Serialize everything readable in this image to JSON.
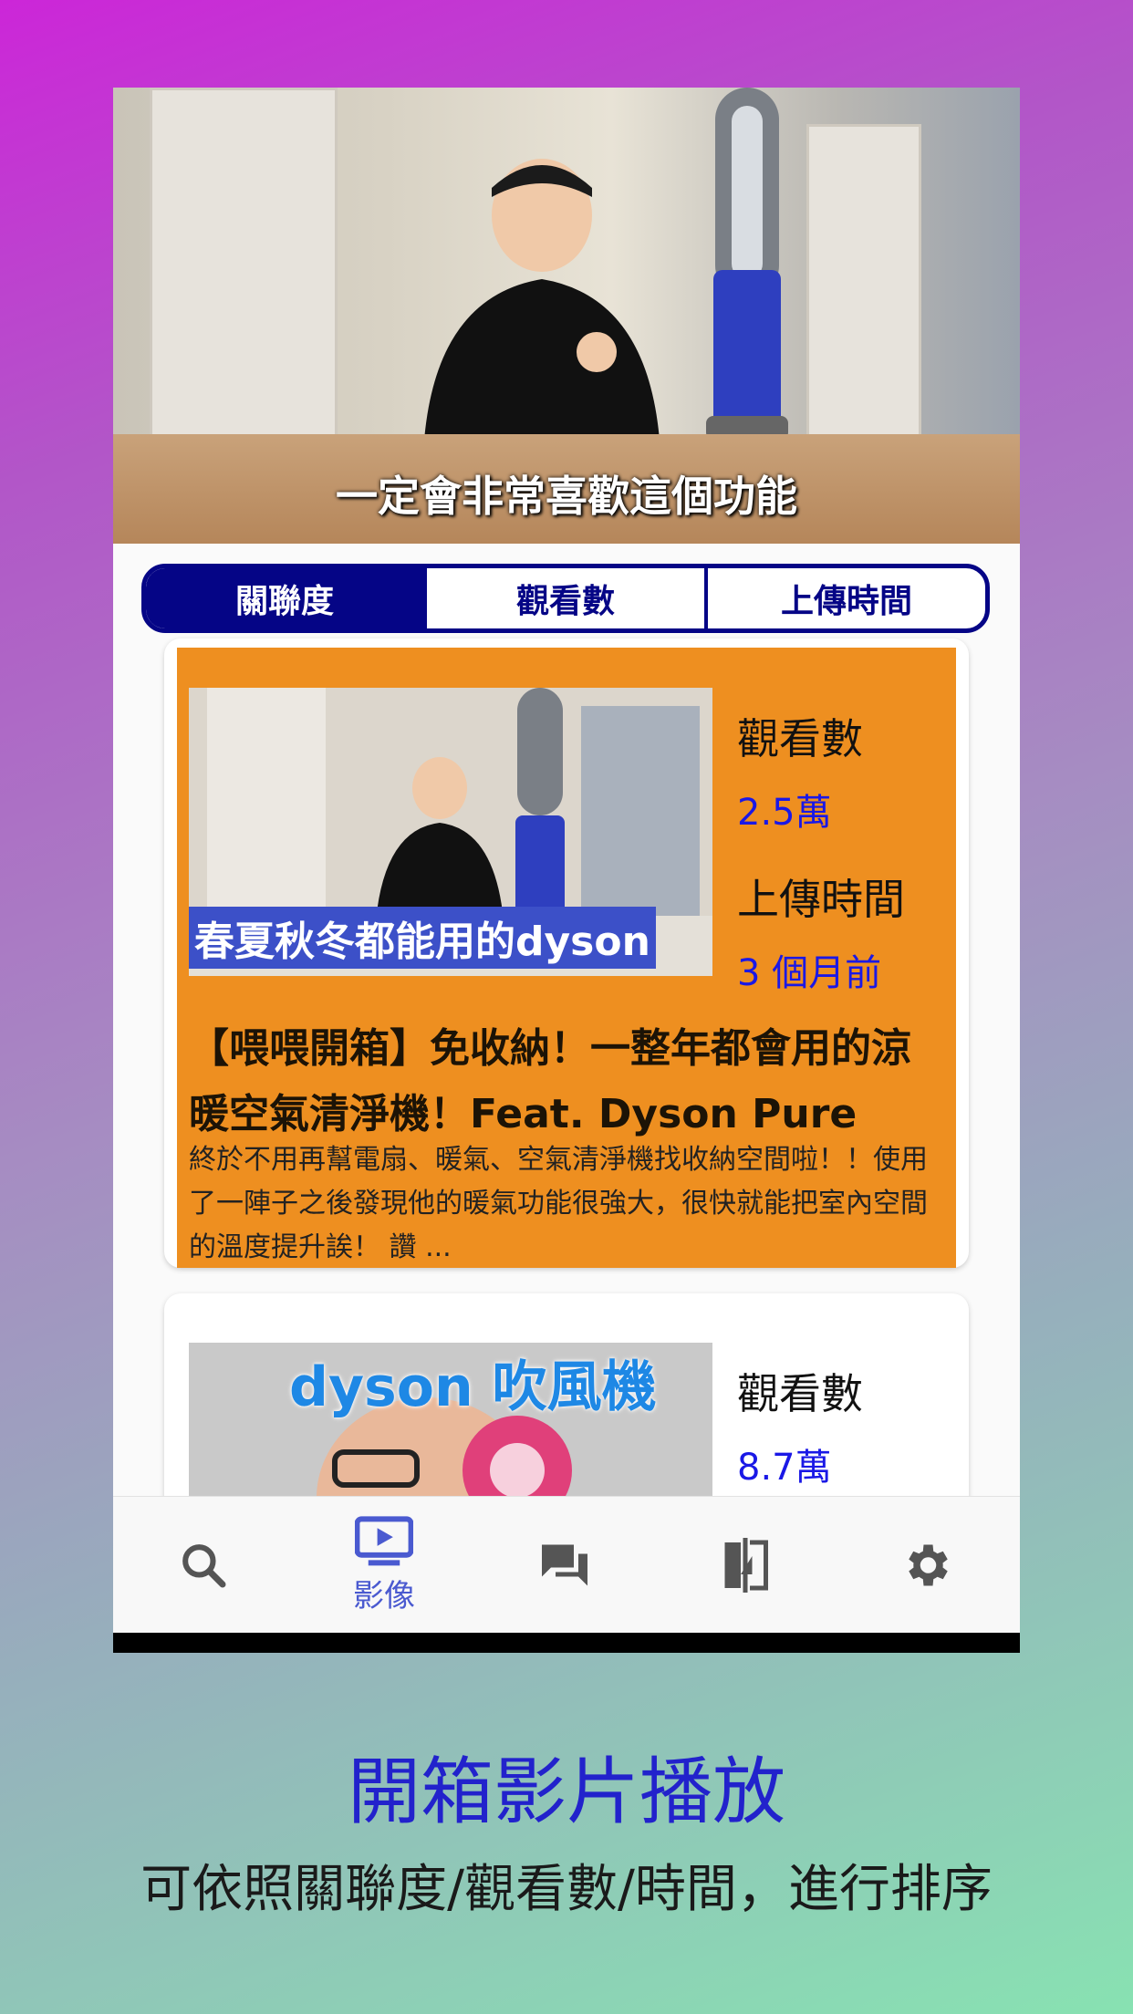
{
  "player": {
    "subtitle": "一定會非常喜歡這個功能"
  },
  "sort_tabs": [
    {
      "label": "關聯度",
      "selected": true
    },
    {
      "label": "觀看數",
      "selected": false
    },
    {
      "label": "上傳時間",
      "selected": false
    }
  ],
  "videos": [
    {
      "thumb_caption": "春夏秋冬都能用的dyson",
      "views_label": "觀看數",
      "views": "2.5萬",
      "upload_label": "上傳時間",
      "upload": "3 個月前",
      "title": "【喂喂開箱】免收納！一整年都會用的涼暖空氣清淨機！Feat. Dyson Pure",
      "description": "終於不用再幫電扇、暖氣、空氣清淨機找收納空間啦！！使用了一陣子之後發現他的暖氣功能很強大，很快就能把室內空間的溫度提升誒！ 讚 ..."
    },
    {
      "thumb_caption": "dyson 吹風機",
      "views_label": "觀看數",
      "views": "8.7萬"
    }
  ],
  "nav": {
    "items": [
      {
        "icon": "search-icon",
        "label": ""
      },
      {
        "icon": "video-icon",
        "label": "影像",
        "active": true
      },
      {
        "icon": "forum-icon",
        "label": ""
      },
      {
        "icon": "compare-icon",
        "label": ""
      },
      {
        "icon": "gear-icon",
        "label": ""
      }
    ]
  },
  "caption": {
    "title": "開箱影片播放",
    "subtitle": "可依照關聯度/觀看數/時間，進行排序"
  },
  "colors": {
    "accent": "#050586",
    "card_highlight": "#ee8f20",
    "value_text": "#1a18e6",
    "nav_active": "#4a5ad0"
  }
}
